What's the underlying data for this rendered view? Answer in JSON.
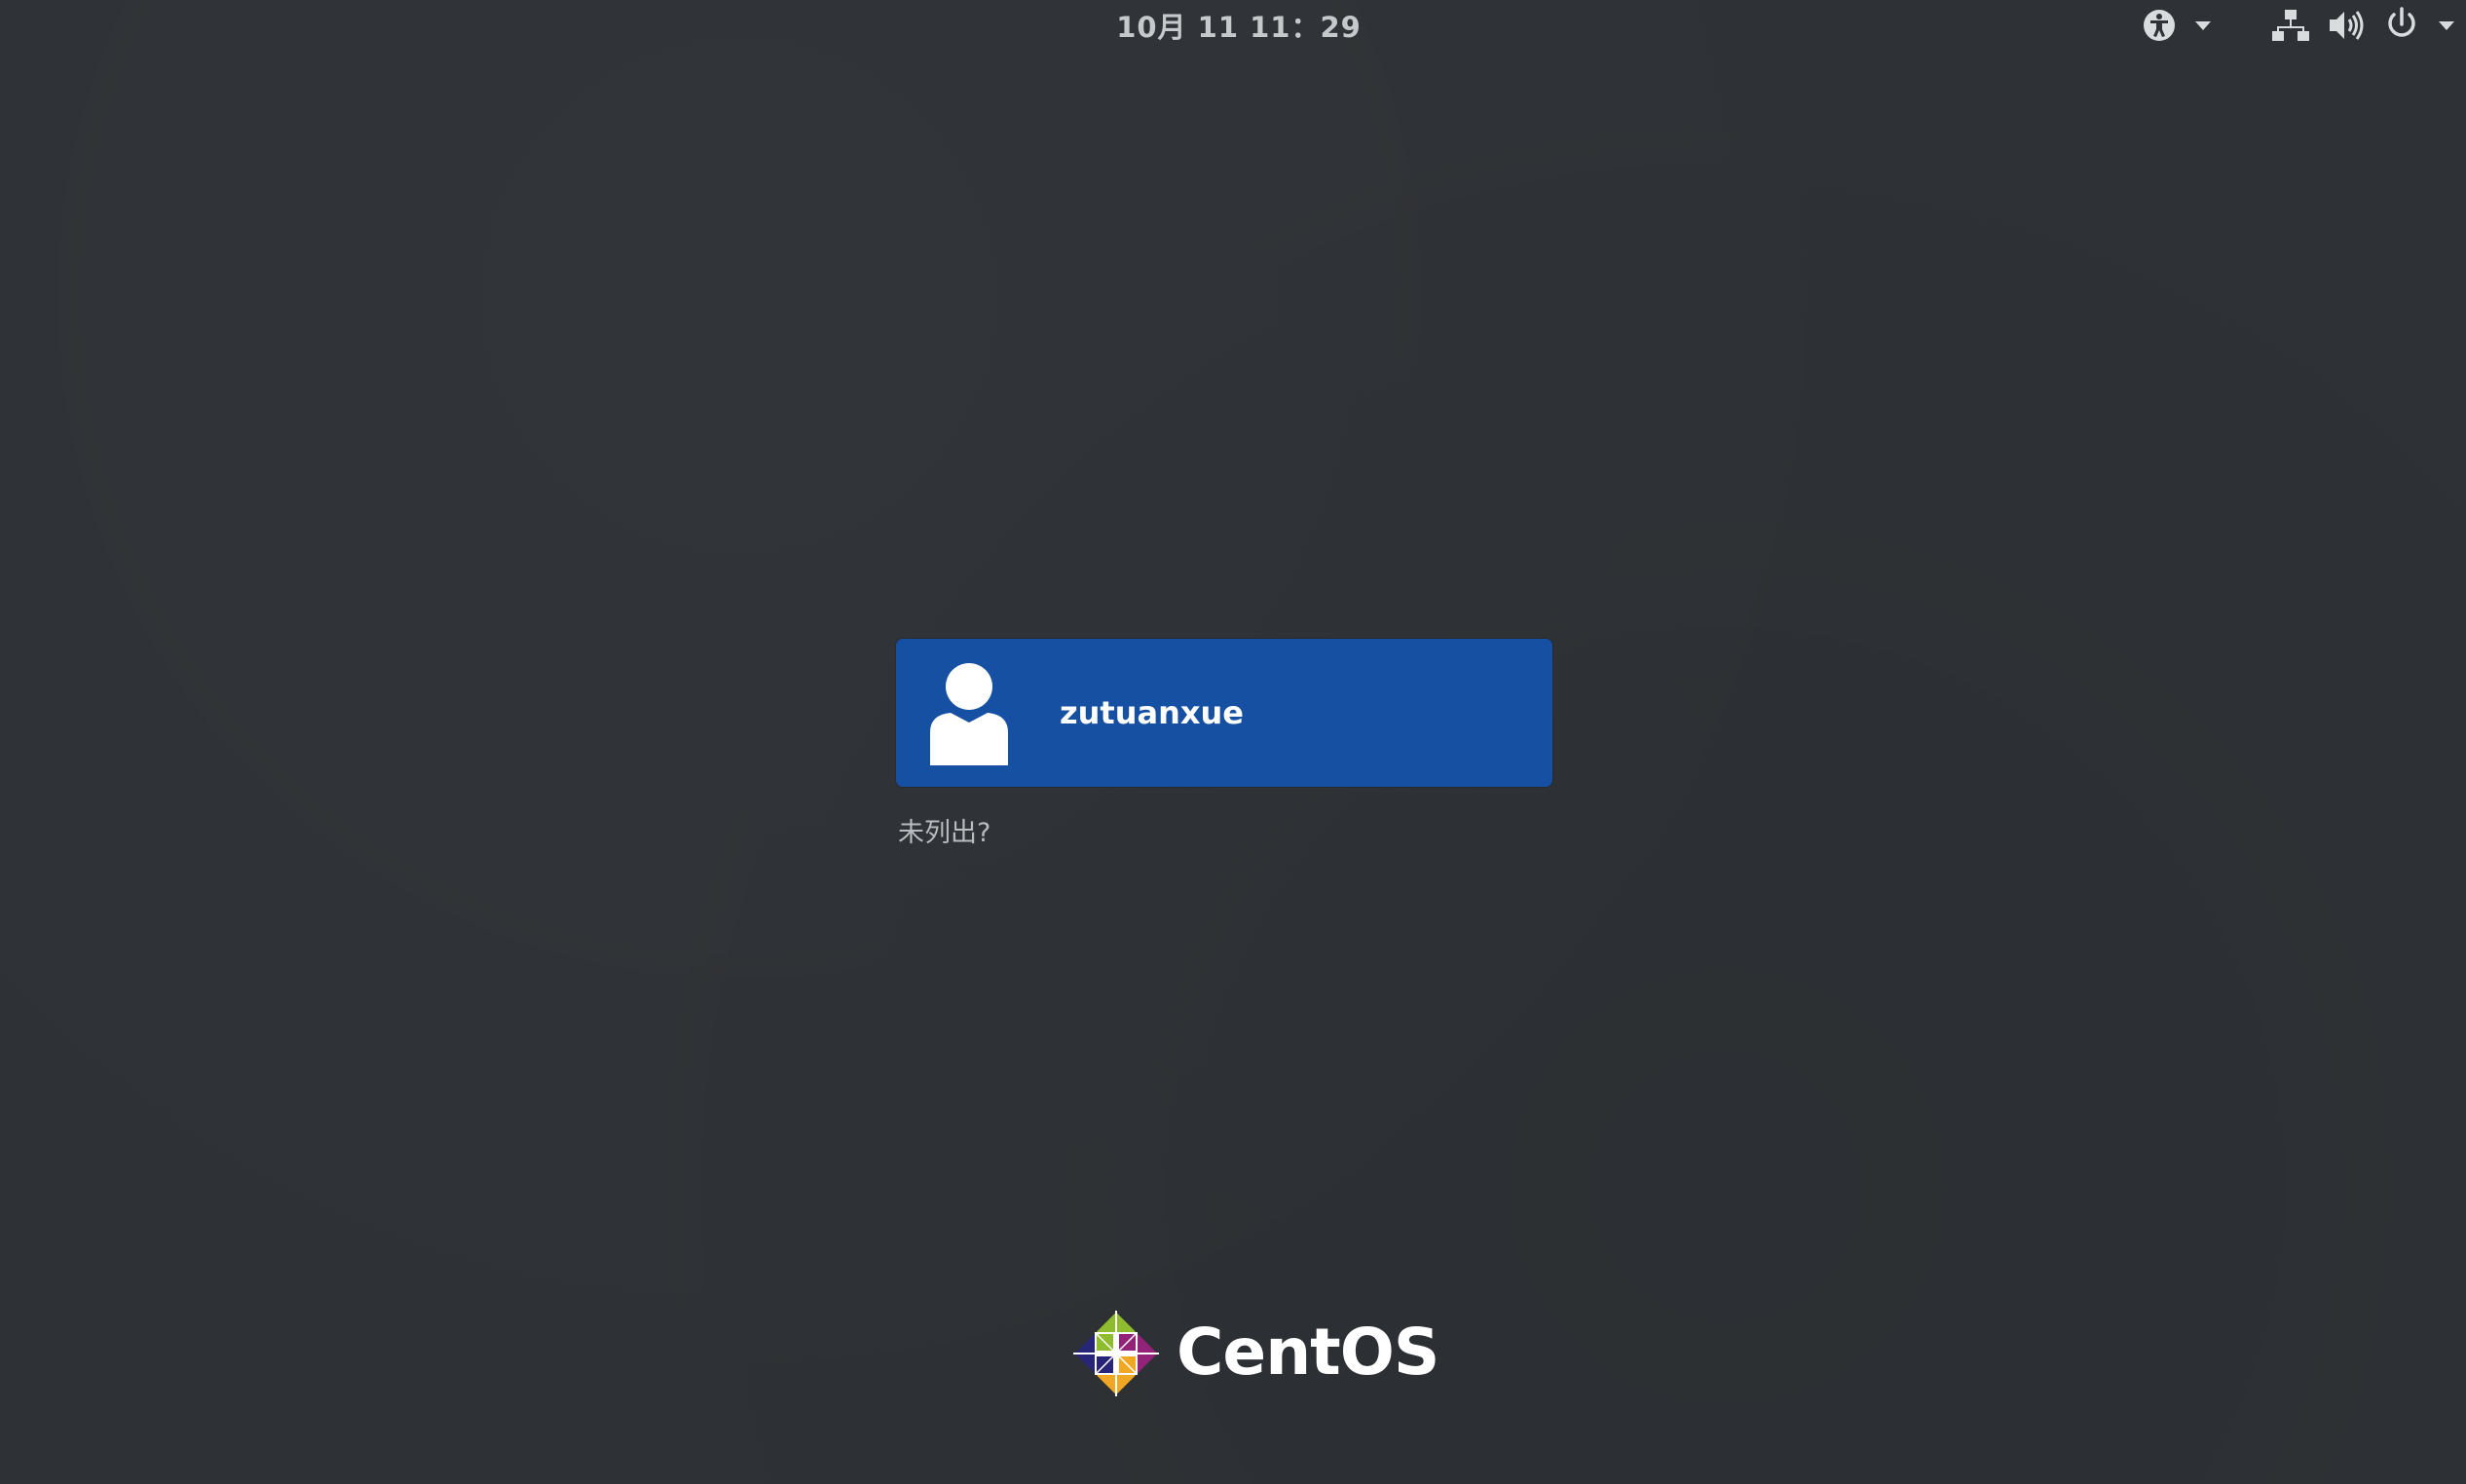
{
  "topbar": {
    "clock": "10月 11  11：29",
    "icons": {
      "accessibility": "accessibility-icon",
      "network": "network-wired-icon",
      "volume": "volume-icon",
      "power": "power-icon"
    }
  },
  "login": {
    "users": [
      {
        "name": "zutuanxue",
        "avatar_icon": "user-avatar-icon"
      }
    ],
    "not_listed_label": "未列出?",
    "selected_color": "#1650a3"
  },
  "branding": {
    "logo_text": "CentOS",
    "logo_icon": "centos-logo-icon"
  },
  "colors": {
    "background": "#2e3236",
    "clock_text": "#c6c9cc"
  }
}
